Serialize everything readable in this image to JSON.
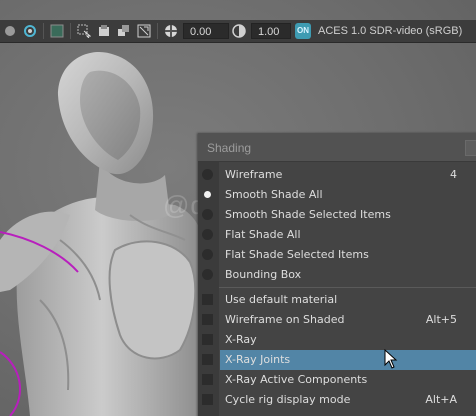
{
  "toolbar": {
    "exposure": "0.00",
    "gamma": "1.00",
    "color_mgmt_toggle": "ON",
    "color_space": "ACES 1.0 SDR-video (sRGB)"
  },
  "watermark": "@dawn_arc",
  "menu": {
    "title": "Shading",
    "items": [
      {
        "label": "Wireframe",
        "shortcut": "4",
        "kind": "radio",
        "selected": false
      },
      {
        "label": "Smooth Shade All",
        "shortcut": "",
        "kind": "radio",
        "selected": true
      },
      {
        "label": "Smooth Shade Selected Items",
        "shortcut": "",
        "kind": "radio",
        "selected": false
      },
      {
        "label": "Flat Shade All",
        "shortcut": "",
        "kind": "radio",
        "selected": false
      },
      {
        "label": "Flat Shade Selected Items",
        "shortcut": "",
        "kind": "radio",
        "selected": false
      },
      {
        "label": "Bounding Box",
        "shortcut": "",
        "kind": "radio",
        "selected": false
      },
      {
        "label": "Use default material",
        "shortcut": "",
        "kind": "check",
        "checked": false
      },
      {
        "label": "Wireframe on Shaded",
        "shortcut": "Alt+5",
        "kind": "check",
        "checked": false
      },
      {
        "label": "X-Ray",
        "shortcut": "",
        "kind": "check",
        "checked": false
      },
      {
        "label": "X-Ray Joints",
        "shortcut": "",
        "kind": "check",
        "checked": false,
        "highlighted": true
      },
      {
        "label": "X-Ray Active Components",
        "shortcut": "",
        "kind": "check",
        "checked": false
      },
      {
        "label": "Cycle rig display mode",
        "shortcut": "Alt+A",
        "kind": "check",
        "checked": false
      }
    ]
  },
  "colors": {
    "toolbar_bg": "#3c3c3c",
    "menu_bg": "#444444",
    "highlight": "#5285a6",
    "accent_toggle": "#3e9bb2",
    "curve": "#b81fbd"
  }
}
